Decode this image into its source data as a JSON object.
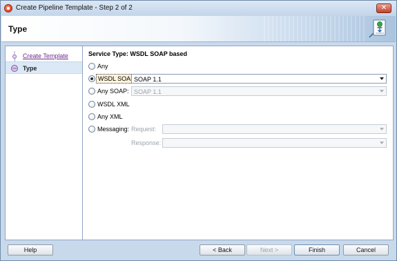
{
  "window": {
    "title": "Create Pipeline Template - Step 2 of 2",
    "close_symbol": "✕"
  },
  "header": {
    "title": "Type",
    "icon": "wizard-document-icon"
  },
  "steps": [
    {
      "label": "Create Template",
      "state": "completed"
    },
    {
      "label": "Type",
      "state": "current"
    }
  ],
  "content": {
    "section_title": "Service Type: WSDL SOAP based",
    "options": {
      "any": {
        "label": "Any",
        "selected": false
      },
      "wsdl_soap": {
        "label": "WSDL SOAP",
        "selected": true,
        "combo_value": "SOAP 1.1"
      },
      "any_soap": {
        "label": "Any SOAP:",
        "selected": false,
        "combo_value": "SOAP 1.1"
      },
      "wsdl_xml": {
        "label": "WSDL XML",
        "selected": false
      },
      "any_xml": {
        "label": "Any XML",
        "selected": false
      },
      "messaging": {
        "label": "Messaging:",
        "selected": false,
        "request_label": "Request:",
        "request_value": "",
        "response_label": "Response:",
        "response_value": ""
      }
    }
  },
  "buttons": {
    "help": "Help",
    "back": "< Back",
    "next": "Next >",
    "finish": "Finish",
    "cancel": "Cancel"
  },
  "colors": {
    "accent_selected_bg": "#dbe8f6",
    "link": "#6b2a87"
  }
}
